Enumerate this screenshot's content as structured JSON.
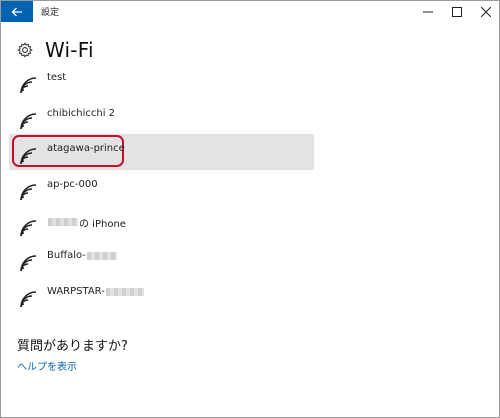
{
  "window": {
    "title": "設定",
    "minimize_glyph": "—",
    "maximize_glyph": "☐",
    "close_glyph": "✕"
  },
  "page": {
    "title": "Wi-Fi",
    "header_icon": "gear-icon"
  },
  "networks": [
    {
      "name": "test",
      "selected": false
    },
    {
      "name": "chibichicchi 2",
      "selected": false
    },
    {
      "name": "atagawa-prince",
      "selected": true
    },
    {
      "name": "ap-pc-000",
      "selected": false
    },
    {
      "name_prefix": "",
      "name": "の iPhone",
      "selected": false
    },
    {
      "name": "Buffalo-",
      "selected": false
    },
    {
      "name": "WARPSTAR-",
      "selected": false
    }
  ],
  "help": {
    "heading": "質問がありますか?",
    "link": "ヘルプを表示"
  },
  "colors": {
    "accent": "#0063b1",
    "highlight_ring": "#c8102e",
    "selected_row": "#e3e3e3"
  }
}
